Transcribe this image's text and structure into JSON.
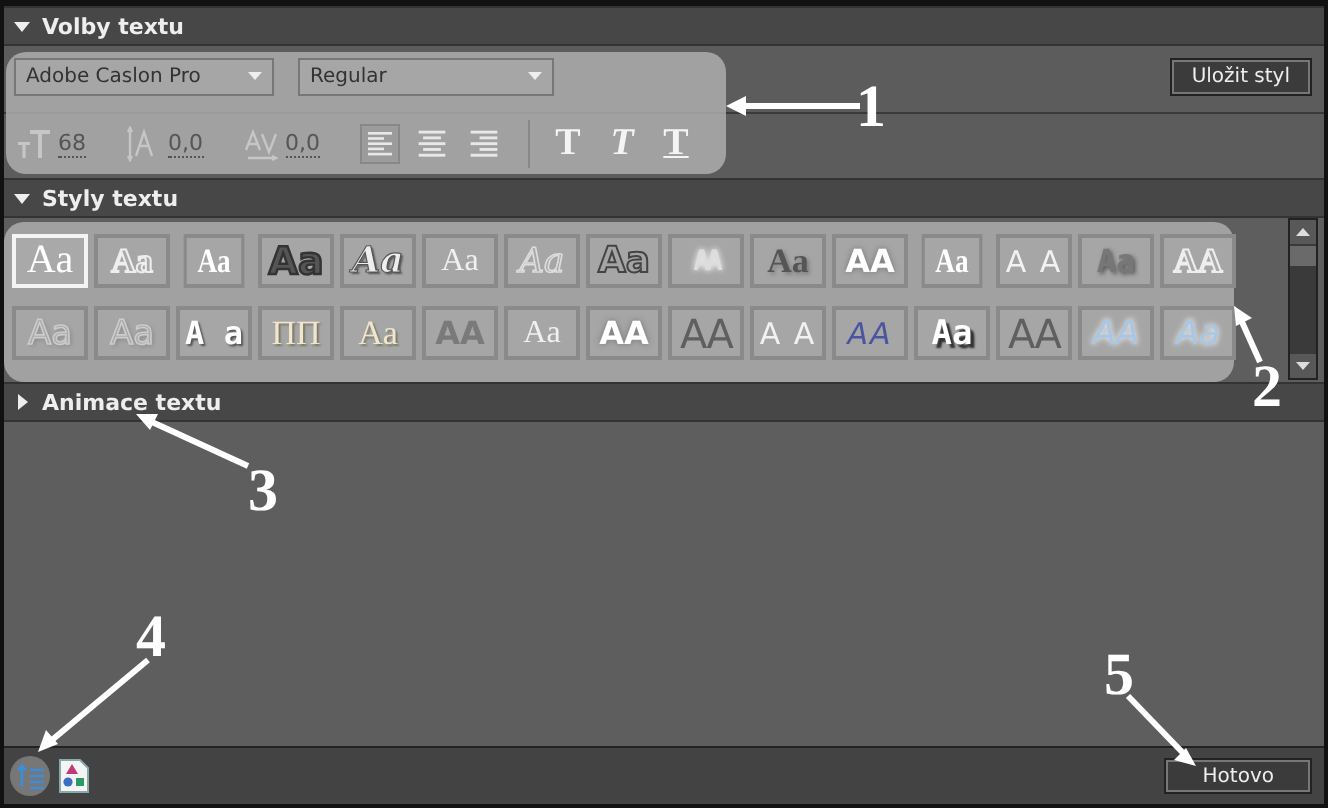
{
  "text_options": {
    "title": "Volby textu",
    "expanded": true,
    "font": "Adobe Caslon Pro",
    "style": "Regular",
    "save_button": "Uložit styl",
    "size": "68",
    "leading": "0,0",
    "kerning": "0,0",
    "alignments": [
      {
        "kind": "left",
        "selected": true
      },
      {
        "kind": "center",
        "selected": false
      },
      {
        "kind": "right",
        "selected": false
      }
    ],
    "formatting": [
      {
        "kind": "bold",
        "label": "T",
        "selected": false
      },
      {
        "kind": "italic",
        "label": "T",
        "selected": false
      },
      {
        "kind": "underline",
        "label": "T",
        "selected": false
      }
    ]
  },
  "text_styles": {
    "title": "Styly textu",
    "expanded": true,
    "swatches": [
      {
        "sample": "Aa",
        "kind": "plain",
        "selected": true
      },
      {
        "sample": "Aa",
        "kind": "outline",
        "selected": false
      },
      {
        "sample": "Aa",
        "kind": "serif-white",
        "selected": false
      },
      {
        "sample": "Aa",
        "kind": "heavy-outline",
        "selected": false
      },
      {
        "sample": "Aa",
        "kind": "script",
        "selected": false
      },
      {
        "sample": "Aa",
        "kind": "faded",
        "selected": false
      },
      {
        "sample": "Aa",
        "kind": "script-faded",
        "selected": false
      },
      {
        "sample": "Aa",
        "kind": "rounded",
        "selected": false
      },
      {
        "sample": "AA",
        "kind": "condensed",
        "selected": false
      },
      {
        "sample": "Aa",
        "kind": "shadow-grey",
        "selected": false
      },
      {
        "sample": "AA",
        "kind": "glow-bold",
        "selected": false
      },
      {
        "sample": "Aa",
        "kind": "serif-white",
        "selected": false
      },
      {
        "sample": "A A",
        "kind": "spaced",
        "selected": false
      },
      {
        "sample": "Aa",
        "kind": "dark",
        "selected": false
      },
      {
        "sample": "AA",
        "kind": "outline",
        "selected": false
      },
      {
        "sample": "Aa",
        "kind": "faded-outline",
        "selected": false
      },
      {
        "sample": "Aa",
        "kind": "faded-outline",
        "selected": false
      },
      {
        "sample": "A a",
        "kind": "white-sans",
        "selected": false
      },
      {
        "sample": "ΠΠ",
        "kind": "cream",
        "selected": false
      },
      {
        "sample": "Aa",
        "kind": "cream",
        "selected": false
      },
      {
        "sample": "AA",
        "kind": "dark-bold",
        "selected": false
      },
      {
        "sample": "Aa",
        "kind": "faded",
        "selected": false
      },
      {
        "sample": "AA",
        "kind": "glow-bold",
        "selected": false
      },
      {
        "sample": "AA",
        "kind": "grey-big",
        "selected": false
      },
      {
        "sample": "A A",
        "kind": "spaced",
        "selected": false
      },
      {
        "sample": "AA",
        "kind": "blue-italic",
        "selected": false
      },
      {
        "sample": "Aa",
        "kind": "black-shadow",
        "selected": false
      },
      {
        "sample": "AA",
        "kind": "grey-big",
        "selected": false
      },
      {
        "sample": "AA",
        "kind": "light-blue",
        "selected": false
      },
      {
        "sample": "Aa",
        "kind": "light-blue",
        "selected": false
      }
    ]
  },
  "text_animation": {
    "title": "Animace textu",
    "expanded": false
  },
  "footer": {
    "done_button": "Hotovo"
  },
  "annotations": [
    {
      "label": "1"
    },
    {
      "label": "2"
    },
    {
      "label": "3"
    },
    {
      "label": "4"
    },
    {
      "label": "5"
    }
  ]
}
